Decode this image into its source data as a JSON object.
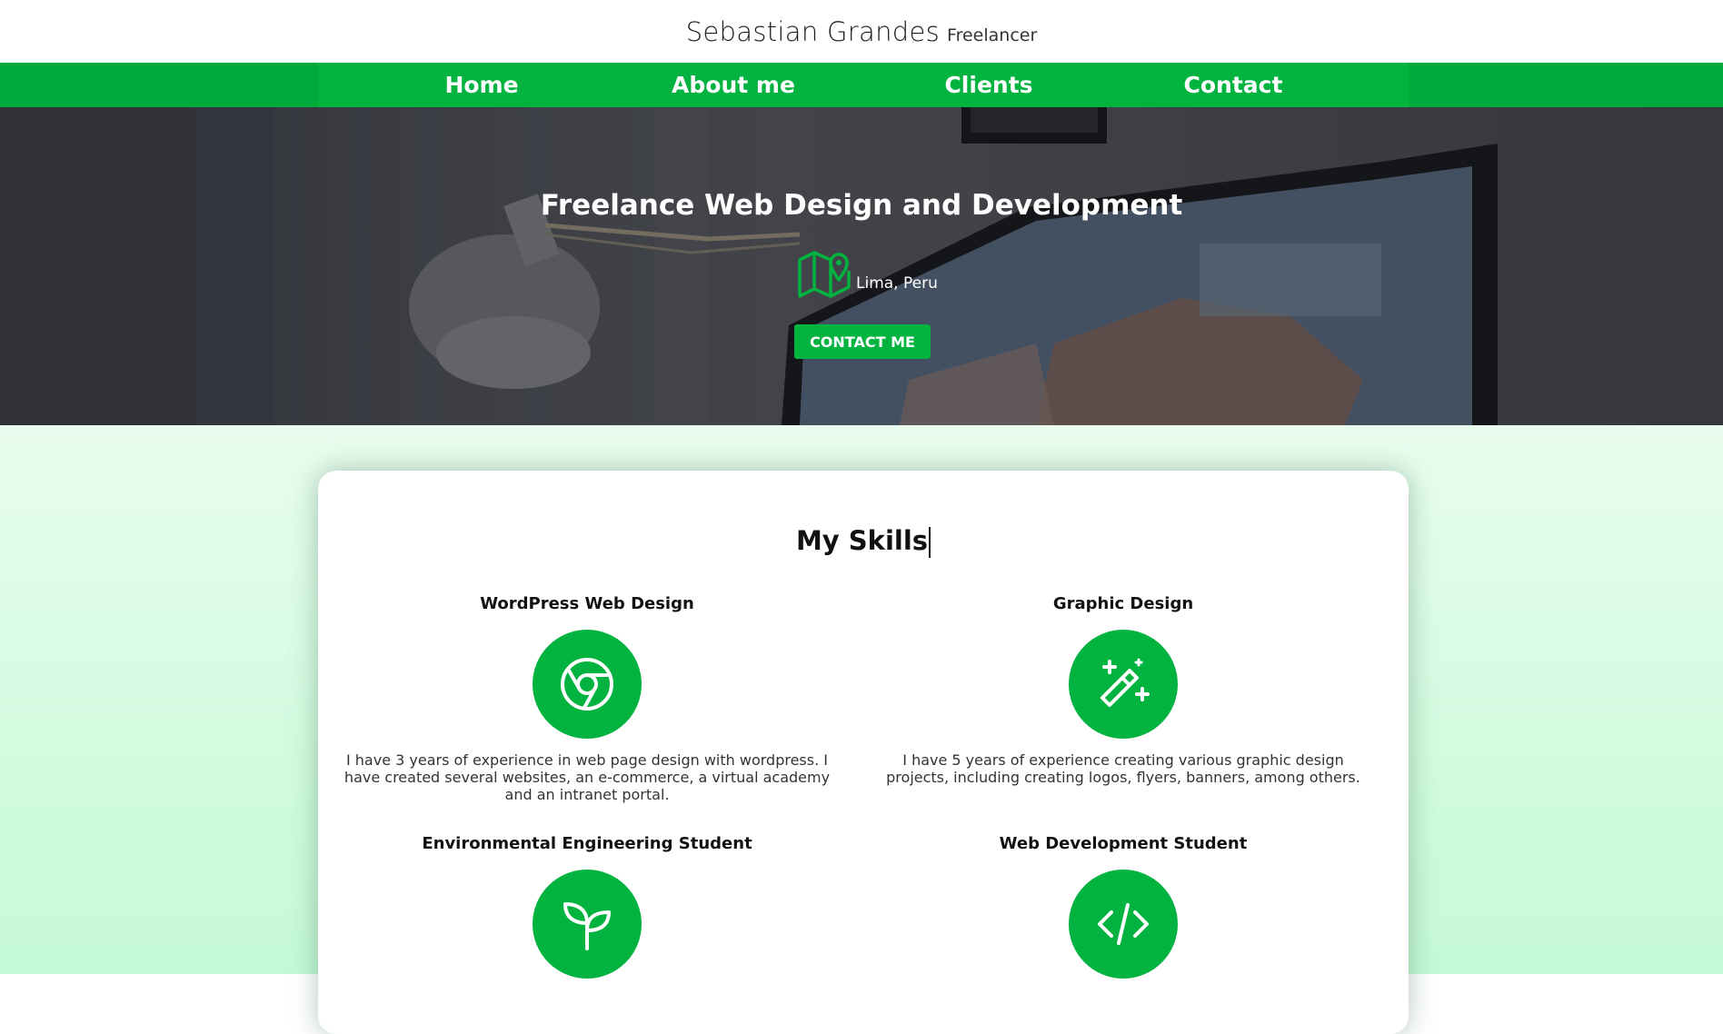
{
  "header": {
    "name": "Sebastian Grandes",
    "subtitle": "Freelancer"
  },
  "nav": {
    "items": [
      {
        "label": "Home"
      },
      {
        "label": "About me"
      },
      {
        "label": "Clients"
      },
      {
        "label": "Contact"
      }
    ]
  },
  "hero": {
    "title": "Freelance Web Design and Development",
    "location": "Lima, Peru",
    "location_icon": "map-pin-icon",
    "button_label": "CONTACT ME"
  },
  "skills": {
    "title": "My Skills",
    "items": [
      {
        "title": "WordPress Web Design",
        "icon": "chrome-icon",
        "description": "I have 3 years of experience in web page design with wordpress. I have created several websites, an e-commerce, a virtual academy and an intranet portal."
      },
      {
        "title": "Graphic Design",
        "icon": "magic-wand-icon",
        "description": "I have 5 years of experience creating various graphic design projects, including creating logos, flyers, banners, among others."
      },
      {
        "title": "Environmental Engineering Student",
        "icon": "plant-icon",
        "description": ""
      },
      {
        "title": "Web Development Student",
        "icon": "code-icon",
        "description": ""
      }
    ]
  },
  "colors": {
    "brand_green": "#03b33f",
    "nav_outer_green": "#01a93a",
    "section_background": "#d3fbe0"
  }
}
